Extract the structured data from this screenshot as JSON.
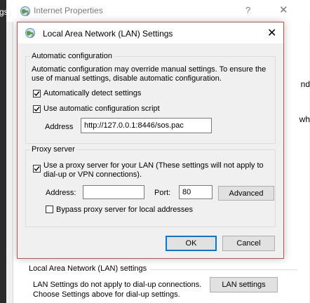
{
  "background_window": {
    "title": "Internet Properties",
    "help_glyph": "?",
    "close_glyph": "✕",
    "left_clip_text": "gs",
    "clipped_text_1": "nd",
    "clipped_text_2": "wh",
    "lan_group_title": "Local Area Network (LAN) settings",
    "lan_info_line1": "LAN Settings do not apply to dial-up connections.",
    "lan_info_line2": "Choose Settings above for dial-up settings.",
    "lan_settings_button": "LAN settings"
  },
  "dialog": {
    "title": "Local Area Network (LAN) Settings",
    "close_glyph": "✕",
    "auto_config": {
      "group_label": "Automatic configuration",
      "description_line1": "Automatic configuration may override manual settings.  To ensure the",
      "description_line2": "use of manual settings, disable automatic configuration.",
      "auto_detect_label": "Automatically detect settings",
      "auto_detect_checked": true,
      "use_script_label": "Use automatic configuration script",
      "use_script_checked": true,
      "address_label": "Address",
      "address_value": "http://127.0.0.1:8446/sos.pac"
    },
    "proxy": {
      "group_label": "Proxy server",
      "use_proxy_label_line1": "Use a proxy server for your LAN (These settings will not apply to",
      "use_proxy_label_line2": "dial-up or VPN connections).",
      "use_proxy_checked": true,
      "address_label": "Address:",
      "address_value": "",
      "port_label": "Port:",
      "port_value": "80",
      "advanced_button": "Advanced",
      "bypass_label": "Bypass proxy server for local addresses",
      "bypass_checked": false
    },
    "ok_button": "OK",
    "cancel_button": "Cancel"
  },
  "colors": {
    "dialog_border": "#c9504a",
    "ok_border": "#0078d7",
    "check_fill": "#ffffff"
  },
  "icons": [
    "globe-icon",
    "close-icon",
    "help-icon",
    "checkmark-icon"
  ]
}
